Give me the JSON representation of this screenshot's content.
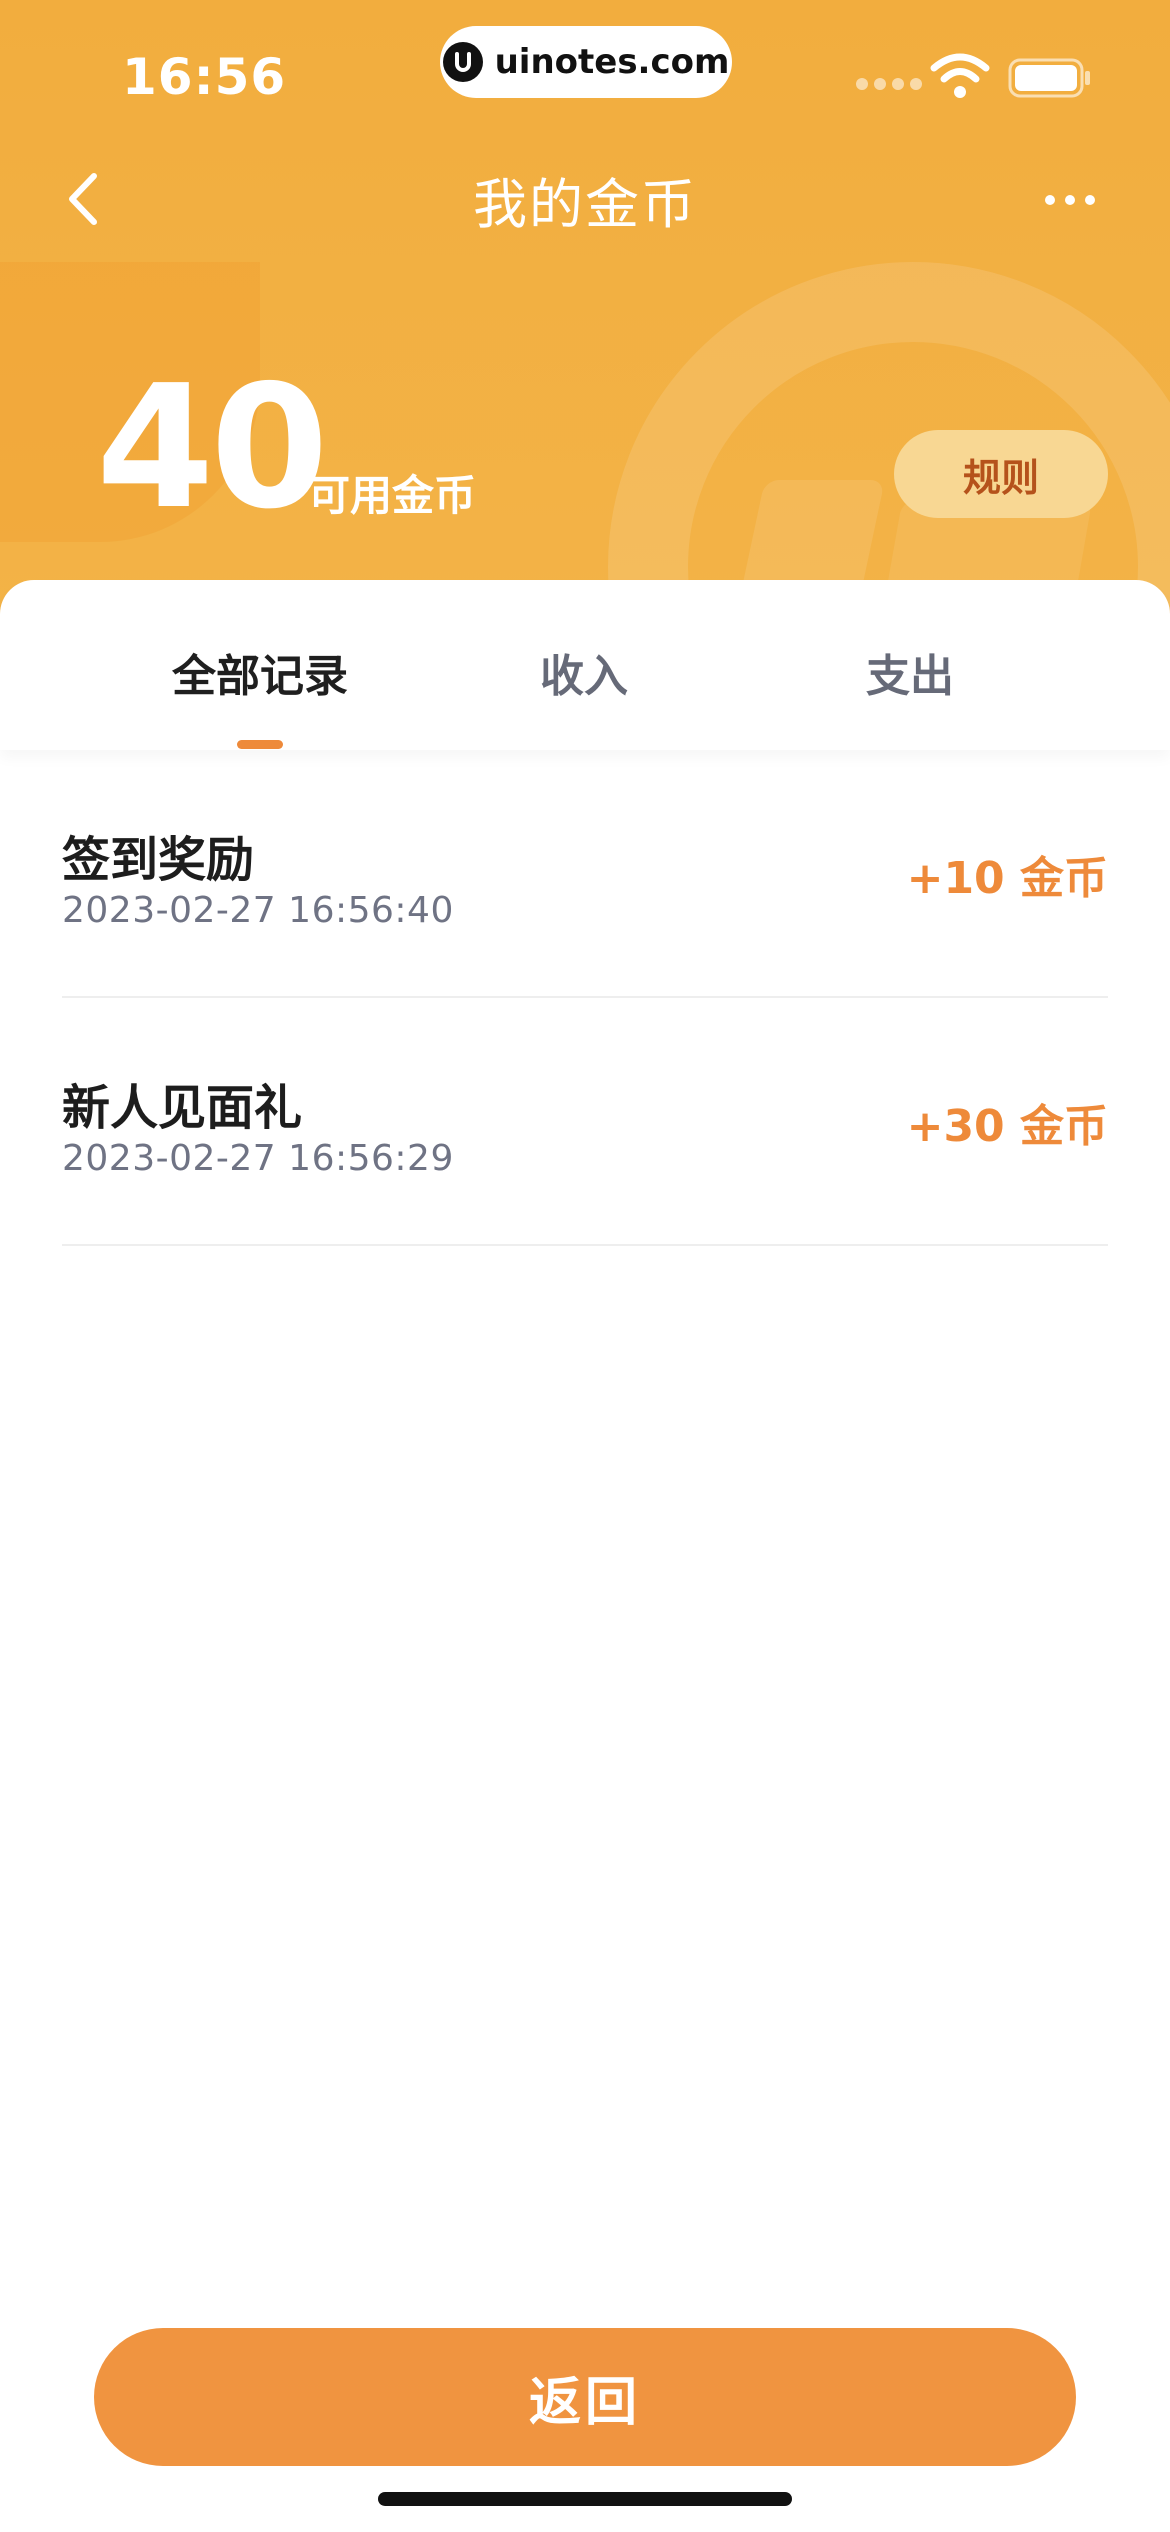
{
  "status_bar": {
    "time": "16:56",
    "url": "uinotes.com"
  },
  "nav": {
    "title": "我的金币",
    "back_icon": "chevron-left-icon",
    "more_icon": "more-dots-icon"
  },
  "balance": {
    "amount": "40",
    "label": "可用金币",
    "rule_button": "规则"
  },
  "tabs": [
    {
      "label": "全部记录",
      "active": true
    },
    {
      "label": "收入",
      "active": false
    },
    {
      "label": "支出",
      "active": false
    }
  ],
  "records": [
    {
      "title": "签到奖励",
      "time": "2023-02-27 16:56:40",
      "amount": "+10 金币"
    },
    {
      "title": "新人见面礼",
      "time": "2023-02-27 16:56:29",
      "amount": "+30 金币"
    }
  ],
  "footer": {
    "return_button": "返回"
  },
  "colors": {
    "header": "#f2ad3e",
    "accent": "#ee8a3a",
    "rule_bg": "#f8d793",
    "rule_text": "#b5521b"
  }
}
